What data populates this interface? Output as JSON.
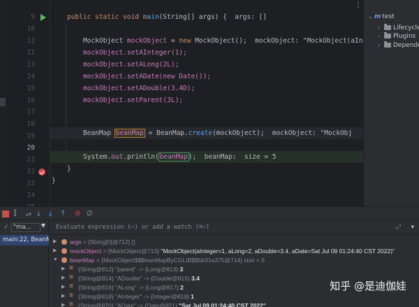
{
  "editor": {
    "gutter": [
      {
        "line": "9",
        "icon": "run"
      },
      {
        "line": "10",
        "icon": ""
      },
      {
        "line": "11",
        "icon": ""
      },
      {
        "line": "12",
        "icon": ""
      },
      {
        "line": "13",
        "icon": ""
      },
      {
        "line": "14",
        "icon": ""
      },
      {
        "line": "15",
        "icon": ""
      },
      {
        "line": "16",
        "icon": ""
      },
      {
        "line": "17",
        "icon": ""
      },
      {
        "line": "18",
        "icon": ""
      },
      {
        "line": "19",
        "icon": ""
      },
      {
        "line": "20",
        "icon": "current"
      },
      {
        "line": "21",
        "icon": ""
      },
      {
        "line": "22",
        "icon": "breakpoint"
      },
      {
        "line": "23",
        "icon": ""
      },
      {
        "line": "24",
        "icon": ""
      },
      {
        "line": "25",
        "icon": ""
      }
    ],
    "code": {
      "l9_kw": "public static void ",
      "l9_fn": "main",
      "l9_rest": "(String[] args) {  ",
      "l9_hint": "args: []",
      "l11_type": "MockObject ",
      "l11_var": "mockObject",
      "l11_rest": " = ",
      "l11_kw": "new ",
      "l11_ctor": "MockObject();  ",
      "l11_hint": "mockObject: \"MockObject(aInt",
      "l12_obj": "mockObject",
      "l12_fn": ".setAInteger(",
      "l12_num": "1",
      "l12_end": ");",
      "l13_obj": "mockObject",
      "l13_fn": ".setALong(",
      "l13_num": "2L",
      "l13_end": ");",
      "l14_obj": "mockObject",
      "l14_fn": ".setADate(",
      "l14_kw": "new ",
      "l14_ctor": "Date());",
      "l15_obj": "mockObject",
      "l15_fn": ".setADouble(",
      "l15_num": "3.4D",
      "l15_end": ");",
      "l16_obj": "mockObject",
      "l16_fn": ".setParent(",
      "l16_num": "3L",
      "l16_end": ");",
      "l20_type": "BeanMap ",
      "l20_var": "beanMap",
      "l20_mid": " = BeanMap.",
      "l20_fn": "create",
      "l20_arg": "(mockObject);  ",
      "l20_hint": "mockObject: \"MockObj",
      "l22_sys": "System.",
      "l22_out": "out",
      "l22_fn": ".println(",
      "l22_var": "beanMap",
      "l22_end": ");  ",
      "l22_hint": "beanMap:  size = 5",
      "l23_brace": "}",
      "l24_brace": "}"
    }
  },
  "project_panel": {
    "options_icon": "⋮",
    "items": [
      {
        "label": "test",
        "icon": "maven-m",
        "expanded": true
      },
      {
        "label": "Lifecycle",
        "icon": "folder",
        "expanded": false
      },
      {
        "label": "Plugins",
        "icon": "folder",
        "expanded": false
      },
      {
        "label": "Depende",
        "icon": "folder",
        "expanded": false
      }
    ]
  },
  "debug": {
    "toolbar_icons": [
      "stop-icon",
      "mute-icon",
      "step-over-icon",
      "step-into-icon",
      "force-step-icon",
      "step-out-icon",
      "breakpoint-icon",
      "settings-icon"
    ],
    "thread_selector": "\"ma...",
    "frame": "main:22, BeanM",
    "eval_placeholder": "Evaluate expression (⏎) or add a watch (⌘⏎)",
    "variables": [
      {
        "name": "args",
        "text": " = {String[0]@712} []",
        "level": 0,
        "expanded": false,
        "icon": "param"
      },
      {
        "name": "mockObject",
        "text": " = {MockObject@713} ",
        "value": "\"MockObject(aInteger=1, aLong=2, aDouble=3.4, aDate=Sat Jul 09 01:24:40 CST 2022)\"",
        "level": 0,
        "expanded": false,
        "icon": "local"
      },
      {
        "name": "beanMap",
        "text": " = {MockObject$$BeanMapByCGLIB$$5b31a375@714}  size = 5",
        "level": 0,
        "expanded": true,
        "icon": "local"
      },
      {
        "name": "",
        "text": "{String@812} \"parent\" -> {Long@813} ",
        "value": "3",
        "level": 1,
        "expanded": false,
        "icon": "entry"
      },
      {
        "name": "",
        "text": "{String@814} \"ADouble\" -> {Double@815} ",
        "value": "3.4",
        "level": 1,
        "expanded": false,
        "icon": "entry"
      },
      {
        "name": "",
        "text": "{String@816} \"ALong\" -> {Long@817} ",
        "value": "2",
        "level": 1,
        "expanded": false,
        "icon": "entry"
      },
      {
        "name": "",
        "text": "{String@818} \"AInteger\" -> {Integer@819} ",
        "value": "1",
        "level": 1,
        "expanded": false,
        "icon": "entry"
      },
      {
        "name": "",
        "text": "{String@820} \"ADate\" -> {Date@821} ",
        "value": "\"Sat Jul 09 01:24:40 CST 2022\"",
        "level": 1,
        "expanded": false,
        "icon": "entry"
      }
    ]
  },
  "watermark": "知乎 @是迪伽娃"
}
